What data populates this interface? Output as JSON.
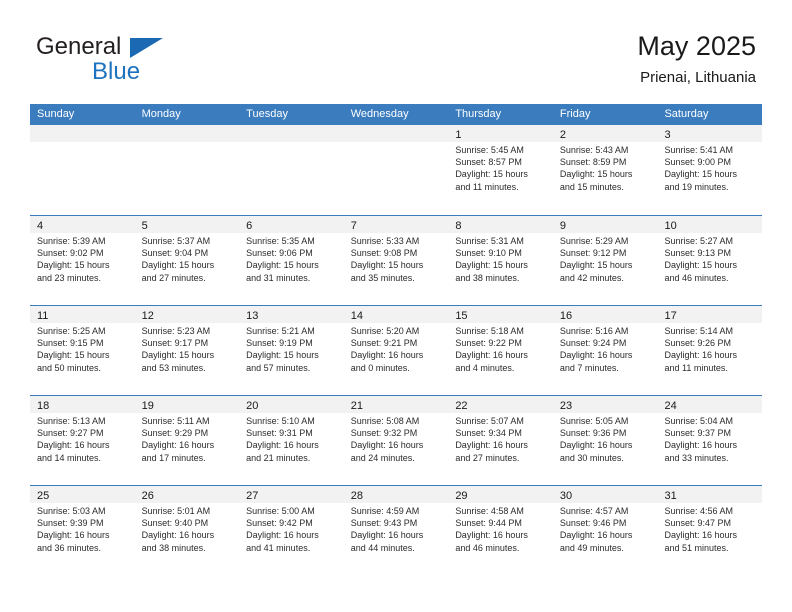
{
  "logo": {
    "word_top": "General",
    "word_bottom": "Blue",
    "triangle_color": "#1b69b2",
    "blue_color": "#1e73be"
  },
  "header": {
    "title": "May 2025",
    "subtitle": "Prienai, Lithuania"
  },
  "theme": {
    "header_blue": "#3a7cbe",
    "day_band_gray": "#f2f2f2",
    "text_color": "#1a1a1a"
  },
  "weekdays": [
    "Sunday",
    "Monday",
    "Tuesday",
    "Wednesday",
    "Thursday",
    "Friday",
    "Saturday"
  ],
  "labels": {
    "sunrise_prefix": "Sunrise:",
    "sunset_prefix": "Sunset:",
    "daylight_prefix": "Daylight:"
  },
  "weeks": [
    [
      {
        "day": "",
        "empty": true
      },
      {
        "day": "",
        "empty": true
      },
      {
        "day": "",
        "empty": true
      },
      {
        "day": "",
        "empty": true
      },
      {
        "day": "1",
        "sunrise": "Sunrise: 5:45 AM",
        "sunset": "Sunset: 8:57 PM",
        "daylight_line1": "Daylight: 15 hours",
        "daylight_line2": "and 11 minutes."
      },
      {
        "day": "2",
        "sunrise": "Sunrise: 5:43 AM",
        "sunset": "Sunset: 8:59 PM",
        "daylight_line1": "Daylight: 15 hours",
        "daylight_line2": "and 15 minutes."
      },
      {
        "day": "3",
        "sunrise": "Sunrise: 5:41 AM",
        "sunset": "Sunset: 9:00 PM",
        "daylight_line1": "Daylight: 15 hours",
        "daylight_line2": "and 19 minutes."
      }
    ],
    [
      {
        "day": "4",
        "sunrise": "Sunrise: 5:39 AM",
        "sunset": "Sunset: 9:02 PM",
        "daylight_line1": "Daylight: 15 hours",
        "daylight_line2": "and 23 minutes."
      },
      {
        "day": "5",
        "sunrise": "Sunrise: 5:37 AM",
        "sunset": "Sunset: 9:04 PM",
        "daylight_line1": "Daylight: 15 hours",
        "daylight_line2": "and 27 minutes."
      },
      {
        "day": "6",
        "sunrise": "Sunrise: 5:35 AM",
        "sunset": "Sunset: 9:06 PM",
        "daylight_line1": "Daylight: 15 hours",
        "daylight_line2": "and 31 minutes."
      },
      {
        "day": "7",
        "sunrise": "Sunrise: 5:33 AM",
        "sunset": "Sunset: 9:08 PM",
        "daylight_line1": "Daylight: 15 hours",
        "daylight_line2": "and 35 minutes."
      },
      {
        "day": "8",
        "sunrise": "Sunrise: 5:31 AM",
        "sunset": "Sunset: 9:10 PM",
        "daylight_line1": "Daylight: 15 hours",
        "daylight_line2": "and 38 minutes."
      },
      {
        "day": "9",
        "sunrise": "Sunrise: 5:29 AM",
        "sunset": "Sunset: 9:12 PM",
        "daylight_line1": "Daylight: 15 hours",
        "daylight_line2": "and 42 minutes."
      },
      {
        "day": "10",
        "sunrise": "Sunrise: 5:27 AM",
        "sunset": "Sunset: 9:13 PM",
        "daylight_line1": "Daylight: 15 hours",
        "daylight_line2": "and 46 minutes."
      }
    ],
    [
      {
        "day": "11",
        "sunrise": "Sunrise: 5:25 AM",
        "sunset": "Sunset: 9:15 PM",
        "daylight_line1": "Daylight: 15 hours",
        "daylight_line2": "and 50 minutes."
      },
      {
        "day": "12",
        "sunrise": "Sunrise: 5:23 AM",
        "sunset": "Sunset: 9:17 PM",
        "daylight_line1": "Daylight: 15 hours",
        "daylight_line2": "and 53 minutes."
      },
      {
        "day": "13",
        "sunrise": "Sunrise: 5:21 AM",
        "sunset": "Sunset: 9:19 PM",
        "daylight_line1": "Daylight: 15 hours",
        "daylight_line2": "and 57 minutes."
      },
      {
        "day": "14",
        "sunrise": "Sunrise: 5:20 AM",
        "sunset": "Sunset: 9:21 PM",
        "daylight_line1": "Daylight: 16 hours",
        "daylight_line2": "and 0 minutes."
      },
      {
        "day": "15",
        "sunrise": "Sunrise: 5:18 AM",
        "sunset": "Sunset: 9:22 PM",
        "daylight_line1": "Daylight: 16 hours",
        "daylight_line2": "and 4 minutes."
      },
      {
        "day": "16",
        "sunrise": "Sunrise: 5:16 AM",
        "sunset": "Sunset: 9:24 PM",
        "daylight_line1": "Daylight: 16 hours",
        "daylight_line2": "and 7 minutes."
      },
      {
        "day": "17",
        "sunrise": "Sunrise: 5:14 AM",
        "sunset": "Sunset: 9:26 PM",
        "daylight_line1": "Daylight: 16 hours",
        "daylight_line2": "and 11 minutes."
      }
    ],
    [
      {
        "day": "18",
        "sunrise": "Sunrise: 5:13 AM",
        "sunset": "Sunset: 9:27 PM",
        "daylight_line1": "Daylight: 16 hours",
        "daylight_line2": "and 14 minutes."
      },
      {
        "day": "19",
        "sunrise": "Sunrise: 5:11 AM",
        "sunset": "Sunset: 9:29 PM",
        "daylight_line1": "Daylight: 16 hours",
        "daylight_line2": "and 17 minutes."
      },
      {
        "day": "20",
        "sunrise": "Sunrise: 5:10 AM",
        "sunset": "Sunset: 9:31 PM",
        "daylight_line1": "Daylight: 16 hours",
        "daylight_line2": "and 21 minutes."
      },
      {
        "day": "21",
        "sunrise": "Sunrise: 5:08 AM",
        "sunset": "Sunset: 9:32 PM",
        "daylight_line1": "Daylight: 16 hours",
        "daylight_line2": "and 24 minutes."
      },
      {
        "day": "22",
        "sunrise": "Sunrise: 5:07 AM",
        "sunset": "Sunset: 9:34 PM",
        "daylight_line1": "Daylight: 16 hours",
        "daylight_line2": "and 27 minutes."
      },
      {
        "day": "23",
        "sunrise": "Sunrise: 5:05 AM",
        "sunset": "Sunset: 9:36 PM",
        "daylight_line1": "Daylight: 16 hours",
        "daylight_line2": "and 30 minutes."
      },
      {
        "day": "24",
        "sunrise": "Sunrise: 5:04 AM",
        "sunset": "Sunset: 9:37 PM",
        "daylight_line1": "Daylight: 16 hours",
        "daylight_line2": "and 33 minutes."
      }
    ],
    [
      {
        "day": "25",
        "sunrise": "Sunrise: 5:03 AM",
        "sunset": "Sunset: 9:39 PM",
        "daylight_line1": "Daylight: 16 hours",
        "daylight_line2": "and 36 minutes."
      },
      {
        "day": "26",
        "sunrise": "Sunrise: 5:01 AM",
        "sunset": "Sunset: 9:40 PM",
        "daylight_line1": "Daylight: 16 hours",
        "daylight_line2": "and 38 minutes."
      },
      {
        "day": "27",
        "sunrise": "Sunrise: 5:00 AM",
        "sunset": "Sunset: 9:42 PM",
        "daylight_line1": "Daylight: 16 hours",
        "daylight_line2": "and 41 minutes."
      },
      {
        "day": "28",
        "sunrise": "Sunrise: 4:59 AM",
        "sunset": "Sunset: 9:43 PM",
        "daylight_line1": "Daylight: 16 hours",
        "daylight_line2": "and 44 minutes."
      },
      {
        "day": "29",
        "sunrise": "Sunrise: 4:58 AM",
        "sunset": "Sunset: 9:44 PM",
        "daylight_line1": "Daylight: 16 hours",
        "daylight_line2": "and 46 minutes."
      },
      {
        "day": "30",
        "sunrise": "Sunrise: 4:57 AM",
        "sunset": "Sunset: 9:46 PM",
        "daylight_line1": "Daylight: 16 hours",
        "daylight_line2": "and 49 minutes."
      },
      {
        "day": "31",
        "sunrise": "Sunrise: 4:56 AM",
        "sunset": "Sunset: 9:47 PM",
        "daylight_line1": "Daylight: 16 hours",
        "daylight_line2": "and 51 minutes."
      }
    ]
  ]
}
